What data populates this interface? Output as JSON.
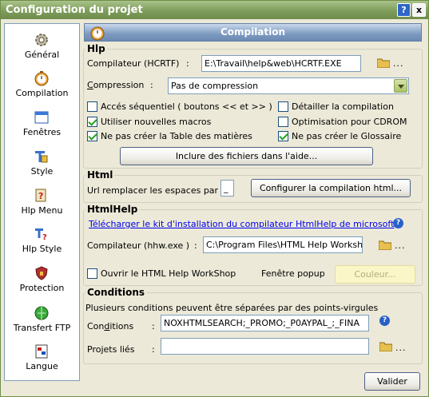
{
  "window": {
    "title": "Configuration du projet",
    "help_btn": "?",
    "close_btn": "x"
  },
  "sidebar": {
    "items": [
      {
        "label": "Général",
        "icon": "gear-icon"
      },
      {
        "label": "Compilation",
        "icon": "timer-icon"
      },
      {
        "label": "Fenêtres",
        "icon": "window-icon"
      },
      {
        "label": "Style",
        "icon": "style-icon"
      },
      {
        "label": "Hlp Menu",
        "icon": "help-menu-icon"
      },
      {
        "label": "Hlp Style",
        "icon": "help-style-icon"
      },
      {
        "label": "Protection",
        "icon": "protection-icon"
      },
      {
        "label": "Transfert FTP",
        "icon": "ftp-icon"
      },
      {
        "label": "Langue",
        "icon": "language-icon"
      }
    ]
  },
  "header": {
    "title": "Compilation"
  },
  "hlp": {
    "title": "Hlp",
    "compiler_label": "Compilateur (HCRTF)",
    "colon": ":",
    "compiler_value": "E:\\Travail\\help&web\\HCRTF.EXE",
    "browse_dots": "...",
    "compression_label": "Compression",
    "compression_value": "Pas de compression",
    "checkboxes": {
      "acces": {
        "label": "Accés séquentiel ( boutons << et >> )",
        "checked": false
      },
      "detail": {
        "label": "Détailler la compilation",
        "checked": false
      },
      "macros": {
        "label": "Utiliser nouvelles macros",
        "checked": true
      },
      "cdrom": {
        "label": "Optimisation pour CDROM",
        "checked": false
      },
      "toc": {
        "label": "Ne pas créer la Table des matières",
        "checked": true
      },
      "glossaire": {
        "label": "Ne pas créer le Glossaire",
        "checked": true
      }
    },
    "include_btn": "Inclure des fichiers dans l'aide..."
  },
  "html": {
    "title": "Html",
    "url_label": "Url remplacer les espaces par",
    "url_value": "_",
    "config_btn": "Configurer la compilation html..."
  },
  "htmlhelp": {
    "title": "HtmlHelp",
    "download_link": "Télécharger le kit d'installation du compilateur HtmlHelp de microsoft",
    "compiler_label": "Compilateur (hhw.exe )",
    "colon": ":",
    "compiler_value": "C:\\Program Files\\HTML Help Workshop",
    "browse_dots": "...",
    "open_workshop": {
      "label": "Ouvrir le HTML Help WorkShop",
      "checked": false
    },
    "popup_label": "Fenêtre popup",
    "color_btn": "Couleur..."
  },
  "conditions": {
    "title": "Conditions",
    "hint": "Plusieurs conditions peuvent être séparées par des points-virgules",
    "cond_label": "Conditions",
    "colon": ":",
    "cond_value": "NOXHTMLSEARCH;_PROMO;_P0AYPAL_;_FINA",
    "linked_label": "Projets liés",
    "linked_value": "",
    "browse_dots": "..."
  },
  "footer": {
    "ok_btn": "Valider"
  },
  "colors": {
    "title_bar": "#7e9c5b",
    "header": "#7d9ac0",
    "link": "#0000ee",
    "check": "#21a121"
  }
}
